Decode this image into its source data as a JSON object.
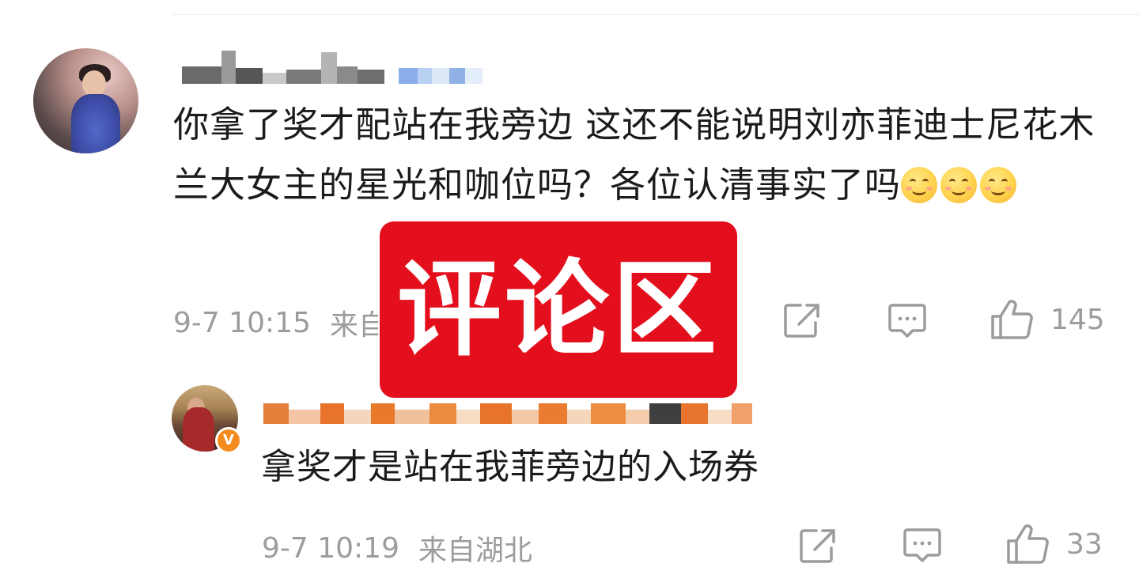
{
  "comment": {
    "username": "",
    "text": "你拿了奖才配站在我旁边 这还不能说明刘亦菲迪士尼花木兰大女主的星光和咖位吗？各位认清事实了吗",
    "emoji_count": 3,
    "emoji_icon": "smile-emoji",
    "time": "9-7 10:15",
    "location": "来自",
    "actions": {
      "share_icon": "share-icon",
      "reply_icon": "comment-icon",
      "like_icon": "thumbs-up-icon",
      "like_count": "145"
    }
  },
  "reply": {
    "username": "",
    "verified_badge": "V",
    "text": "拿奖才是站在我菲旁边的入场券",
    "time": "9-7 10:19",
    "location": "来自湖北",
    "actions": {
      "share_icon": "share-icon",
      "reply_icon": "comment-icon",
      "like_icon": "thumbs-up-icon",
      "like_count": "33"
    }
  },
  "overlay": {
    "label": "评论区",
    "background": "#e30f1d"
  },
  "colors": {
    "meta_text": "#9c9c9c",
    "body_text": "#1b1b1b"
  }
}
